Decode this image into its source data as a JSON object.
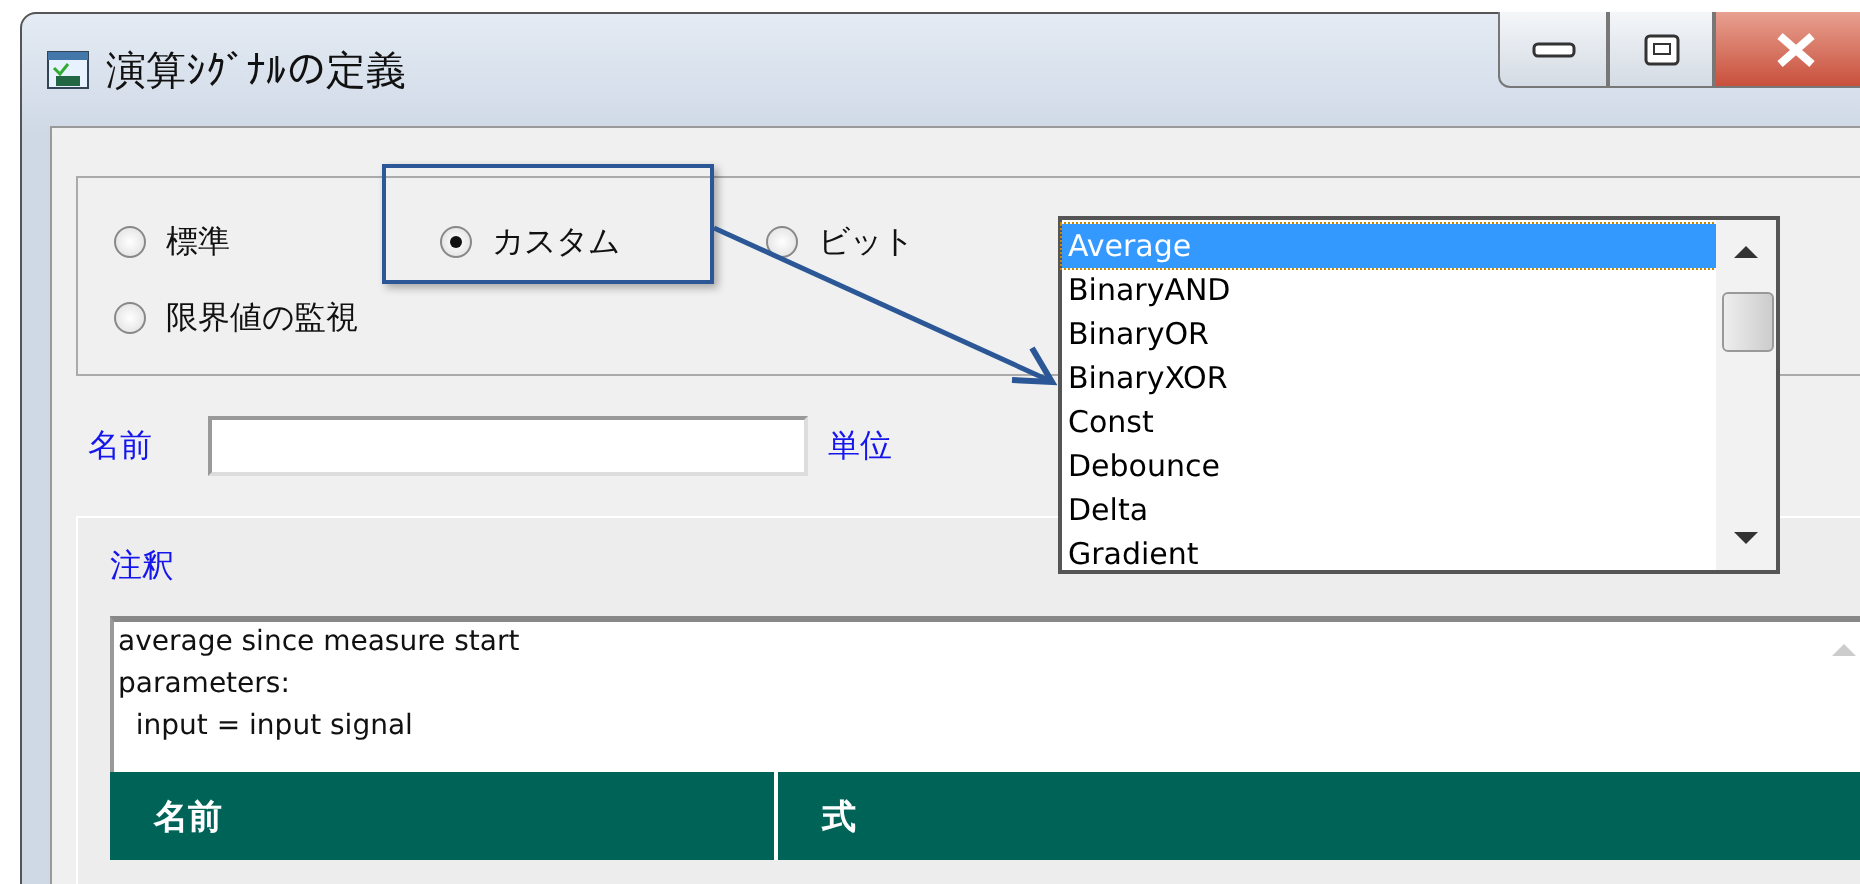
{
  "window": {
    "title": "演算ｼｸﾞﾅﾙの定義"
  },
  "signal_types": [
    {
      "label": "標準",
      "selected": false
    },
    {
      "label": "カスタム",
      "selected": true
    },
    {
      "label": "ビット",
      "selected": false
    },
    {
      "label": "限界値の監視",
      "selected": false
    }
  ],
  "function_list": [
    {
      "label": "Average",
      "selected": true
    },
    {
      "label": "BinaryAND",
      "selected": false
    },
    {
      "label": "BinaryOR",
      "selected": false
    },
    {
      "label": "BinaryXOR",
      "selected": false
    },
    {
      "label": "Const",
      "selected": false
    },
    {
      "label": "Debounce",
      "selected": false
    },
    {
      "label": "Delta",
      "selected": false
    },
    {
      "label": "Gradient",
      "selected": false
    }
  ],
  "name_label": "名前",
  "unit_label": "単位",
  "annotation": {
    "label": "注釈",
    "text": "average since measure start\nparameters:\n  input = input signal"
  },
  "table": {
    "columns": [
      "名前",
      "式"
    ]
  }
}
